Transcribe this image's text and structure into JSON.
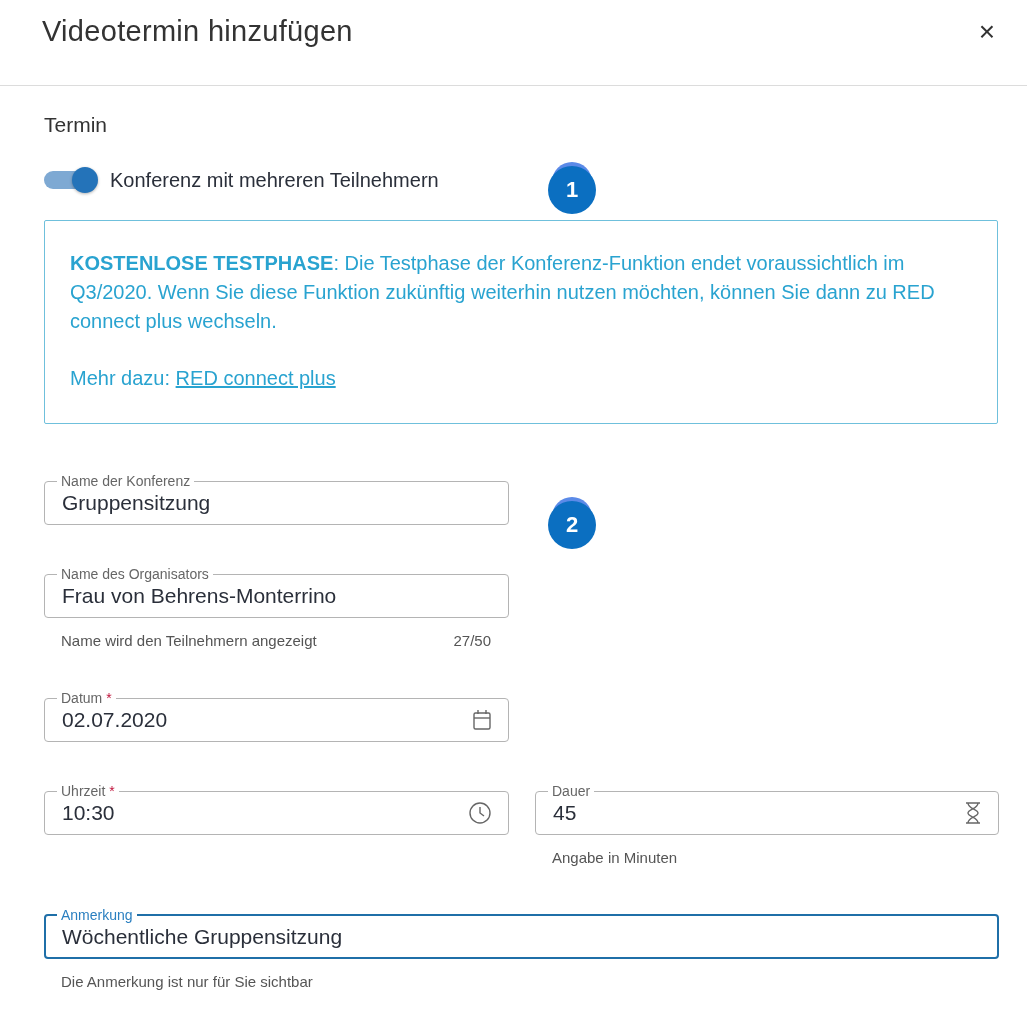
{
  "dialog": {
    "title": "Videotermin hinzufügen",
    "close": "×"
  },
  "section": "Termin",
  "toggle": {
    "label": "Konferenz mit mehreren Teilnehmern",
    "on": true
  },
  "notice": {
    "text": "**KOSTENLOSE TESTPHASE**: Die Testphase der Konferenz-Funktion endet voraussichtlich im Q3/2020. Wenn Sie diese Funktion zukünftig weiterhin nutzen möchten, können Sie dann zu RED connect plus wechseln.",
    "more": "Mehr dazu: ",
    "link": "RED connect plus"
  },
  "fields": [
    {
      "kind": "text",
      "label": "Name der Konferenz",
      "value": "Gruppensitzung",
      "focused": false
    },
    {
      "kind": "text",
      "label": "Name des Organisators",
      "value": "Frau von Behrens-Monterrino",
      "helper": "Name wird den Teilnehmern angezeigt",
      "counter": "27/50",
      "focused": false
    },
    {
      "kind": "date",
      "label": "Datum",
      "required_mark": "*",
      "value": "02.07.2020",
      "focused": false
    },
    {
      "kind": "time",
      "label": "Uhrzeit",
      "required_mark": "*",
      "value": "10:30",
      "focused": false
    },
    {
      "kind": "duration",
      "label": "Dauer",
      "value": "45",
      "helper": "Angabe in Minuten",
      "focused": false
    },
    {
      "kind": "note",
      "label": "Anmerkung",
      "value": "Wöchentliche Gruppensitzung",
      "helper": "Die Anmerkung ist nur für Sie sichtbar",
      "focused": true
    }
  ],
  "callouts": [
    "1",
    "2"
  ]
}
